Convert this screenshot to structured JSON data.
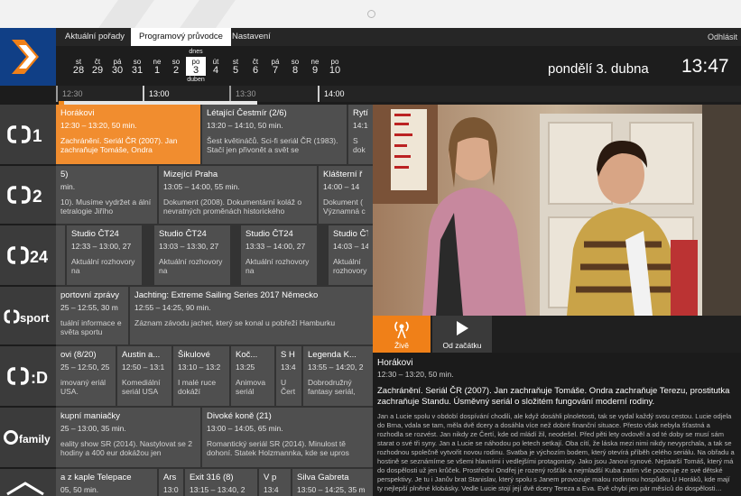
{
  "nav": {
    "tabs": [
      "Aktuální pořady",
      "Programový průvodce",
      "Nastavení"
    ],
    "active_tab": 1,
    "logout_label": "Odhlásit"
  },
  "dates": {
    "days": [
      {
        "name": "st",
        "num": "28"
      },
      {
        "name": "čt",
        "num": "29"
      },
      {
        "name": "pá",
        "num": "30"
      },
      {
        "name": "so",
        "num": "31"
      },
      {
        "name": "ne",
        "num": "1"
      },
      {
        "name": "so",
        "num": "2"
      },
      {
        "name": "po",
        "num": "3",
        "today": true
      },
      {
        "name": "út",
        "num": "4"
      },
      {
        "name": "st",
        "num": "5"
      },
      {
        "name": "čt",
        "num": "6"
      },
      {
        "name": "pá",
        "num": "7"
      },
      {
        "name": "so",
        "num": "8"
      },
      {
        "name": "ne",
        "num": "9"
      },
      {
        "name": "po",
        "num": "10"
      }
    ],
    "today_label": "dnes",
    "today_month": "duben",
    "current_date": "pondělí 3. dubna",
    "current_time": "13:47"
  },
  "timeline": {
    "marks": [
      "12:30",
      "13:00",
      "13:30",
      "14:00"
    ]
  },
  "channels": [
    {
      "name": "ČT1",
      "logo": "ct1-logo"
    },
    {
      "name": "ČT2",
      "logo": "ct2-logo"
    },
    {
      "name": "ČT24",
      "logo": "ct24-logo"
    },
    {
      "name": "ČT sport",
      "logo": "ctsport-logo"
    },
    {
      "name": "ČT :D",
      "logo": "ctd-logo"
    },
    {
      "name": "ČT family",
      "logo": "ctfamily-logo"
    },
    {
      "name": "ČT art",
      "logo": "ctart-logo"
    }
  ],
  "programs": [
    [
      {
        "title": "Horákovi",
        "time": "12:30 – 13:20, 50 min.",
        "desc": "Zachránění. Seriál ČR (2007). Jan zachraňuje Tomáše, Ondra",
        "live": true
      },
      {
        "title": "Létající Čestmír (2/6)",
        "time": "13:20 – 14:10, 50 min.",
        "desc": "Šest květináčů. Sci-fi seriál ČR (1983). Stačí jen přivonět a svět se"
      },
      {
        "title": "Rytí",
        "time": "14:10",
        "desc": "S dok"
      }
    ],
    [
      {
        "title": "5)",
        "time": "min.",
        "desc": "10). Musíme vydržet a ální tetralogie Jiřího"
      },
      {
        "title": "Mizející Praha",
        "time": "13:05 – 14:00, 55 min.",
        "desc": "Dokument (2008). Dokumentární koláž o nevratných proměnách historického"
      },
      {
        "title": "Klášterní ř",
        "time": "14:00 – 14",
        "desc": "Dokument ( Významná c"
      }
    ],
    [
      {
        "title": "",
        "time": "",
        "desc": ""
      },
      {
        "title": "Studio ČT24",
        "time": "12:33 – 13:00, 27",
        "desc": "Aktuální rozhovory na"
      },
      {
        "title": "Studio ČT24",
        "time": "13:03 – 13:30, 27",
        "desc": "Aktuální rozhovory na"
      },
      {
        "title": "Studio ČT24",
        "time": "13:33 – 14:00, 27",
        "desc": "Aktuální rozhovory na"
      },
      {
        "title": "Studio ČT",
        "time": "14:03 – 14",
        "desc": "Aktuální rozhovory na"
      }
    ],
    [
      {
        "title": "portovní zprávy",
        "time": "25 – 12:55, 30 m",
        "desc": "tuální informace e světa sportu"
      },
      {
        "title": "Jachting: Extreme Sailing Series 2017 Německo",
        "time": "12:55 – 14:25, 90 min.",
        "desc": "Záznam závodu jachet, který se konal u pobřeží Hamburku"
      }
    ],
    [
      {
        "title": "ovi (8/20)",
        "time": "25 – 12:50, 25 m",
        "desc": "imovaný eriál USA."
      },
      {
        "title": "Austin a...",
        "time": "12:50 – 13:1",
        "desc": "Komediální seriál USA"
      },
      {
        "title": "Šikulové",
        "time": "13:10 – 13:2",
        "desc": "I malé ruce dokáží"
      },
      {
        "title": "Koč...",
        "time": "13:25",
        "desc": "Animova seriál"
      },
      {
        "title": "S H",
        "time": "13:4",
        "desc": "U Čert"
      },
      {
        "title": "Legenda K...",
        "time": "13:55 – 14:20, 2",
        "desc": "Dobrodružný fantasy seriál,"
      }
    ],
    [
      {
        "title": "kupní maniačky",
        "time": "25 – 13:00, 35 min.",
        "desc": "eality show SR (2014). Nastylovat se 2 hodiny a 400 eur dokážou jen"
      },
      {
        "title": "Divoké koně (21)",
        "time": "13:00 – 14:05, 65 min.",
        "desc": "Romantický seriál SR (2014). Minulost tě dohoní. Statek Holzmannka, kde se upros"
      }
    ],
    [
      {
        "title": "a z kaple Telepace",
        "time": "05, 50 min.",
        "desc": ""
      },
      {
        "title": "Ars",
        "time": "13:0",
        "desc": ""
      },
      {
        "title": "Exit 316 (8)",
        "time": "13:15 – 13:40, 2",
        "desc": ""
      },
      {
        "title": "V p",
        "time": "13:4",
        "desc": ""
      },
      {
        "title": "Silva Gabreta",
        "time": "13:50 – 14:25, 35 m",
        "desc": ""
      }
    ]
  ],
  "player": {
    "live_label": "Živě",
    "start_label": "Od začátku"
  },
  "detail": {
    "title": "Horákovi",
    "time": "12:30 – 13:20, 50 min.",
    "desc": "Zachránění. Seriál ČR (2007). Jan zachraňuje Tomáše. Ondra zachraňuje Terezu, prostitutka zachraňuje Standu. Úsměvný seriál o složitém fungování moderní rodiny.",
    "long": "Jan a Lucie spolu v období dospívání chodili, ale když dosáhli plnoletosti, tak se vydal každý svou cestou. Lucie odjela do Brna, vdala se tam, měla dvě dcery a dosáhla více než dobré finanční situace. Přesto však nebyla šťastná a rozhodla se rozvést. Jan nikdy ze Čertí, kde od mládí žil, neodešel. Před pěti lety ovdověl a od té doby se musí sám starat o své tři syny. Jan a Lucie se náhodou po letech setkají. Oba cítí, že láska mezi nimi nikdy nevyprchala, a tak se rozhodnou společně vytvořit novou rodinu. Svatba je výchozím bodem, který otevírá příběh celého seriálu. Na obřadu a hostině se seznámíme se všemi hlavními i vedlejšími protagonisty. Jako jsou Janovi synové. Nejstarší Tomáš, který má do dospělosti už jen krůček. Prostřední Ondřej je rozený rošťák a nejmladší Kuba zatím vše pozoruje ze své dětské perspektivy. Je tu i Janův brat Stanislav, který spolu s Janem provozuje malou rodinnou hospůdku U Horáků, kde mají ty nejlepší plněné klobásky. Vedle Lucie stojí její dvě dcery Tereza a Eva. Evě chybí jen pár měsíců do dospělosti…"
  },
  "colors": {
    "accent": "#f08018",
    "brand": "#103f86"
  }
}
